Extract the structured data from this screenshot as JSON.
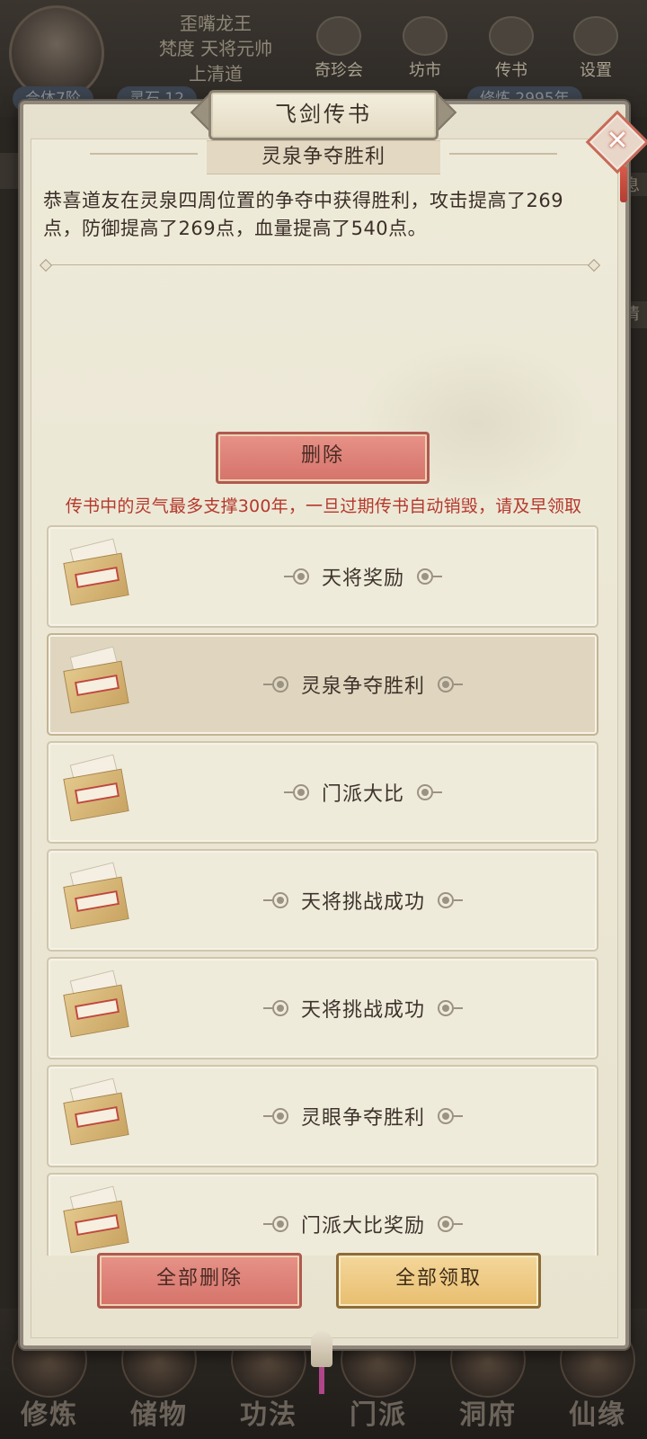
{
  "background": {
    "player_name": "歪嘴龙王",
    "player_titles": [
      "梵度 天将元帅",
      "上清道"
    ],
    "realm_badge": "合体7阶",
    "stat_left": "灵石 12",
    "stat_right": "修炼 2995年",
    "top_buttons": [
      "奇珍会",
      "坊市",
      "传书",
      "设置"
    ],
    "side_right": "清",
    "side_right_2": "息",
    "bottom_nav": [
      "修炼",
      "储物",
      "功法",
      "门派",
      "洞府",
      "仙缘"
    ]
  },
  "modal": {
    "title": "飞剑传书",
    "close_label": "✕",
    "message": {
      "title": "灵泉争夺胜利",
      "body": "恭喜道友在灵泉四周位置的争夺中获得胜利，攻击提高了269点，防御提高了269点，血量提高了540点。"
    },
    "delete_label": "删除",
    "notice": "传书中的灵气最多支撑300年，一旦过期传书自动销毁，请及早领取",
    "items": [
      {
        "title": "天将奖励"
      },
      {
        "title": "灵泉争夺胜利",
        "selected": true
      },
      {
        "title": "门派大比"
      },
      {
        "title": "天将挑战成功"
      },
      {
        "title": "天将挑战成功"
      },
      {
        "title": "灵眼争夺胜利"
      },
      {
        "title": "门派大比奖励"
      }
    ],
    "delete_all_label": "全部删除",
    "claim_all_label": "全部领取"
  },
  "colors": {
    "accent_red": "#d5736a",
    "notice_red": "#b4382c",
    "gold_button": "#e8be6f",
    "panel_bg": "#eeead9"
  },
  "icons": {
    "letter": "envelope-icon",
    "close": "close-icon",
    "bell": "bell-icon"
  }
}
